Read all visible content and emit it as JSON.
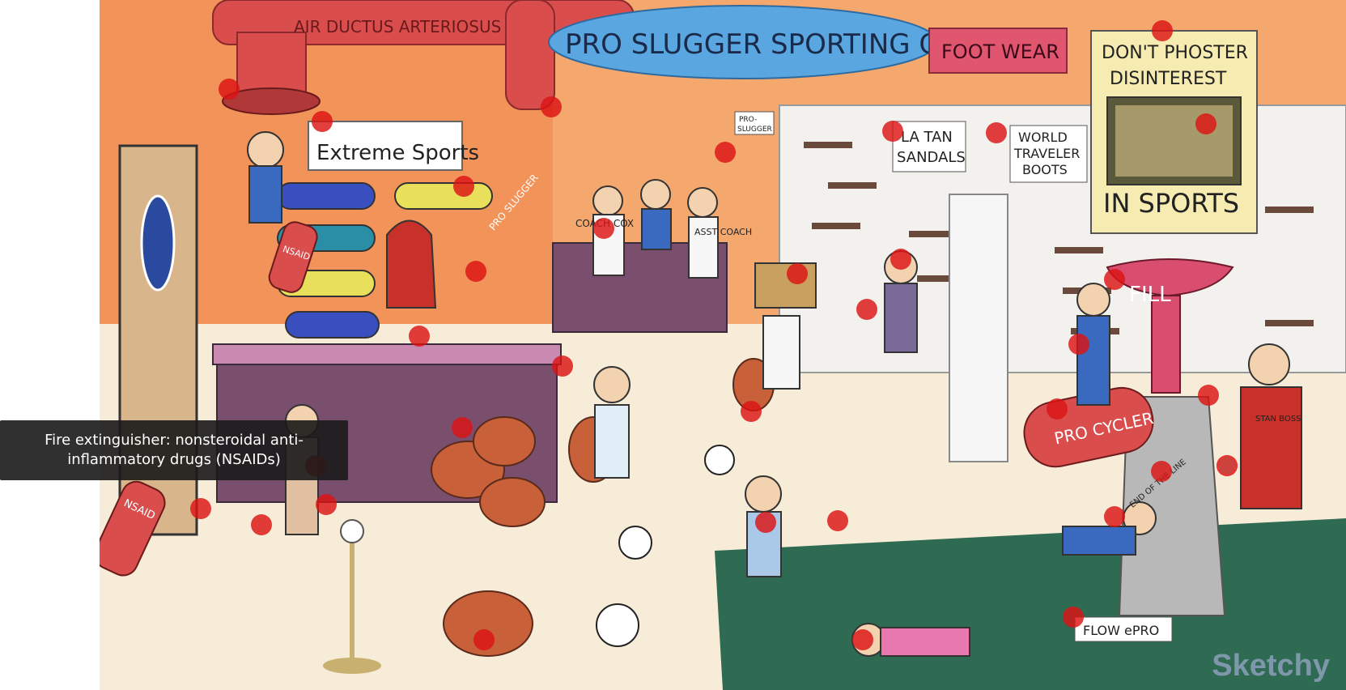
{
  "tooltip": {
    "text": "Fire extinguisher: nonsteroidal anti-inflammatory drugs (NSAIDs)"
  },
  "signs": {
    "duct": "AIR DUCTUS ARTERIOSUS",
    "store": "PRO SLUGGER SPORTING GOODS",
    "footwear": "FOOT WEAR",
    "poster_top1": "DON'T PHOSTER",
    "poster_top2": "DISINTEREST",
    "poster_bottom": "IN SPORTS",
    "extreme": "Extreme Sports",
    "sandals1": "LA TAN",
    "sandals2": "SANDALS",
    "boots1": "WORLD",
    "boots2": "TRAVELER",
    "boots3": "BOOTS",
    "bat_sign1": "PRO-",
    "bat_sign2": "SLUGGER",
    "fill": "FILL",
    "pro_cycler": "PRO CYCLER",
    "extinguisher": "NSAID",
    "coach": "COACH COX",
    "asst": "ASST COACH",
    "stan_boss": "STAN BOSS",
    "end_of_line": "END OF THE LINE",
    "flow_pro": "FLOW ePRO",
    "bat_label": "PRO SLUGGER"
  },
  "watermark": "Sketchy",
  "colors": {
    "hotspot": "#dc1414",
    "wall": "#f2935a",
    "floor": "#f7ecd8",
    "green_mat": "#2f6b52"
  },
  "hotspot_count": 48
}
